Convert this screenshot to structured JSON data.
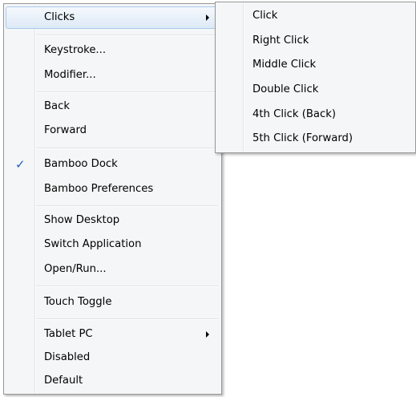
{
  "context_menu": {
    "clicks": "Clicks",
    "keystroke": "Keystroke...",
    "modifier": "Modifier...",
    "back": "Back",
    "forward": "Forward",
    "checkmark": "✓",
    "bamboo_dock": "Bamboo Dock",
    "bamboo_preferences": "Bamboo Preferences",
    "show_desktop": "Show Desktop",
    "switch_application": "Switch Application",
    "open_run": "Open/Run...",
    "touch_toggle": "Touch Toggle",
    "tablet_pc": "Tablet PC",
    "disabled": "Disabled",
    "default": "Default"
  },
  "clicks_submenu": {
    "click": "Click",
    "right_click": "Right Click",
    "middle_click": "Middle Click",
    "double_click": "Double Click",
    "fourth_click": "4th Click (Back)",
    "fifth_click": "5th Click (Forward)"
  }
}
